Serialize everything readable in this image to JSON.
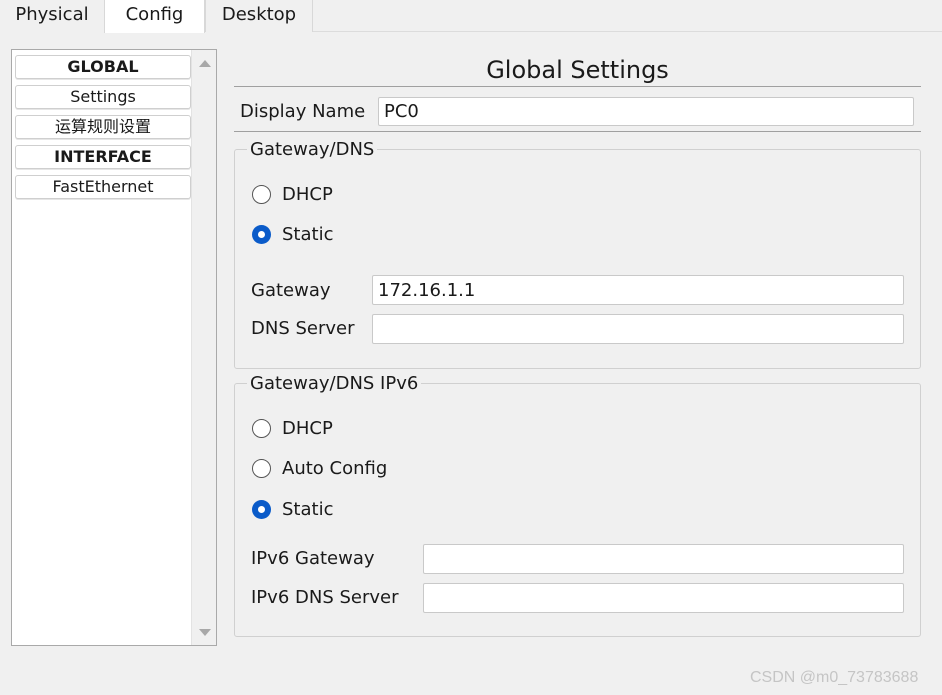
{
  "tabs": [
    {
      "label": "Physical",
      "active": false
    },
    {
      "label": "Config",
      "active": true
    },
    {
      "label": "Desktop",
      "active": false
    }
  ],
  "sidebar": {
    "items": [
      {
        "label": "GLOBAL",
        "type": "header"
      },
      {
        "label": "Settings",
        "type": "item"
      },
      {
        "label": "运算规则设置",
        "type": "item"
      },
      {
        "label": "INTERFACE",
        "type": "header"
      },
      {
        "label": "FastEthernet",
        "type": "item"
      }
    ]
  },
  "main": {
    "title": "Global Settings",
    "display_name": {
      "label": "Display Name",
      "value": "PC0"
    },
    "gateway_dns": {
      "legend": "Gateway/DNS",
      "mode": "Static",
      "options": [
        "DHCP",
        "Static"
      ],
      "gateway": {
        "label": "Gateway",
        "value": "172.16.1.1"
      },
      "dns_server": {
        "label": "DNS Server",
        "value": ""
      }
    },
    "gateway_dns_ipv6": {
      "legend": "Gateway/DNS IPv6",
      "mode": "Static",
      "options": [
        "DHCP",
        "Auto Config",
        "Static"
      ],
      "ipv6_gateway": {
        "label": "IPv6 Gateway",
        "value": ""
      },
      "ipv6_dns_server": {
        "label": "IPv6 DNS Server",
        "value": ""
      }
    }
  },
  "watermark": "CSDN @m0_73783688",
  "colors": {
    "accent": "#0a5bc9",
    "background": "#f0f0f0",
    "input_bg": "#ffffff"
  }
}
